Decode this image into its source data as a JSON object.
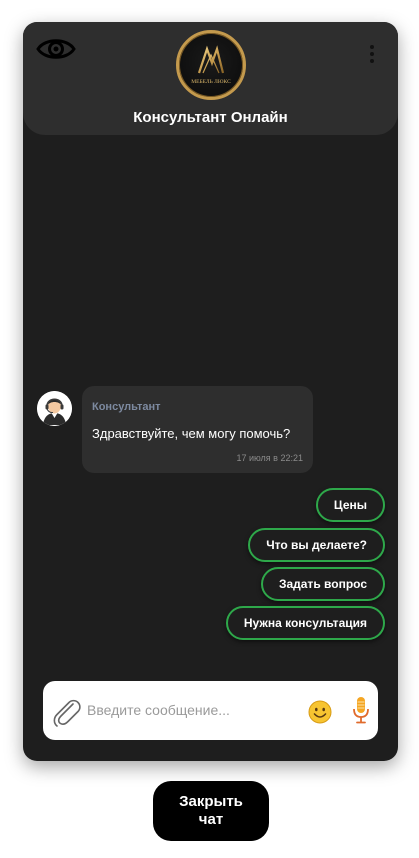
{
  "header": {
    "title": "Консультант Онлайн",
    "logo_text": "МЕБЕЛЬ ЛЮКС",
    "eye_icon": "eye-icon",
    "menu_icon": "more-vertical-icon"
  },
  "messages": [
    {
      "sender": "Консультант",
      "text": "Здравствуйте, чем могу помочь?",
      "time": "17 июля в 22:21",
      "avatar_icon": "consultant-avatar-icon"
    }
  ],
  "quick_replies": [
    "Цены",
    "Что вы делаете?",
    "Задать вопрос",
    "Нужна консультация"
  ],
  "input": {
    "placeholder": "Введите сообщение...",
    "value": "",
    "attach_icon": "paperclip-icon",
    "emoji_icon": "smile-emoji-icon",
    "mic_icon": "microphone-icon"
  },
  "close_button": {
    "label": "Закрыть чат"
  },
  "colors": {
    "widget_bg": "#1e1e1e",
    "header_bg": "#2e2e2e",
    "accent_green": "#2ea84a",
    "logo_gold": "#c49a4d",
    "sender_name": "#7d8aa0"
  }
}
